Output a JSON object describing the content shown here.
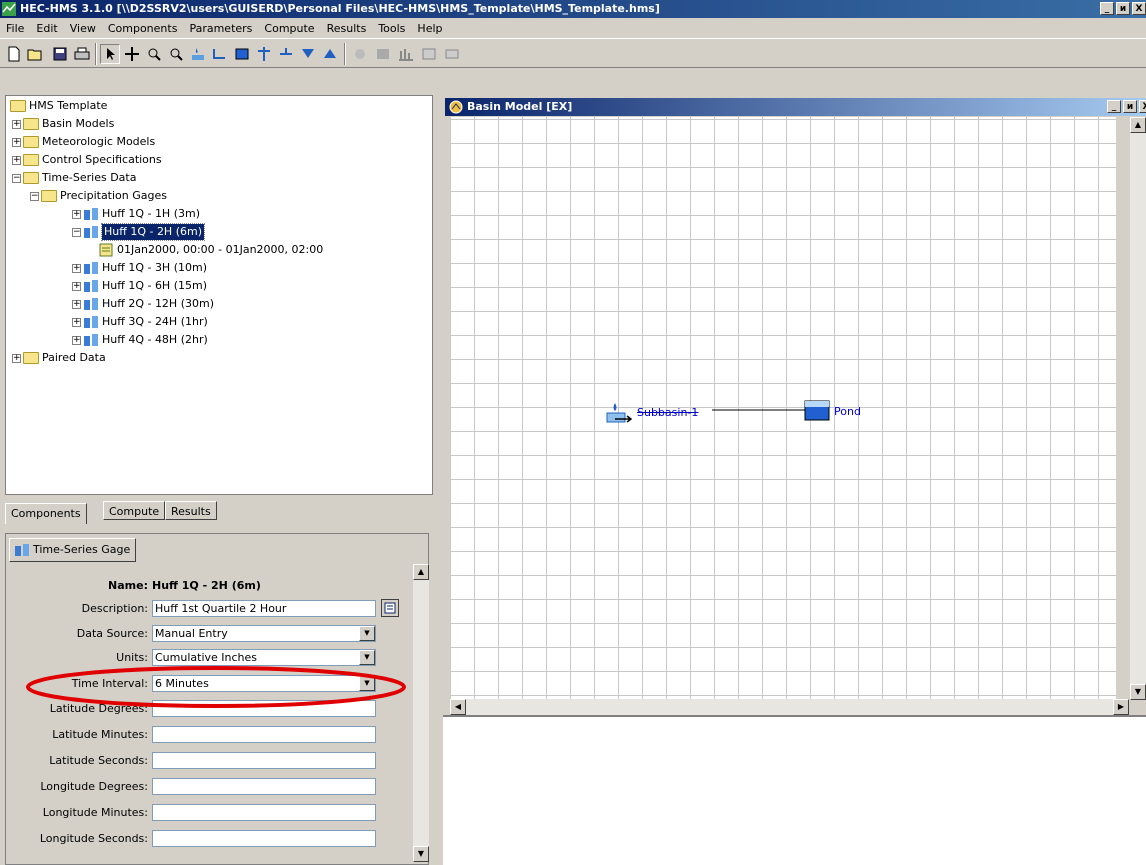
{
  "window": {
    "title": "HEC-HMS 3.1.0 [\\\\D2SSRV2\\users\\GUISERD\\Personal Files\\HEC-HMS\\HMS_Template\\HMS_Template.hms]",
    "minimize": "_",
    "restore": "и",
    "close": "X"
  },
  "menu": [
    "File",
    "Edit",
    "View",
    "Components",
    "Parameters",
    "Compute",
    "Results",
    "Tools",
    "Help"
  ],
  "toolbar_icons": [
    "new-file-icon",
    "open-folder-icon",
    "save-icon",
    "print-icon",
    "arrow-select-icon",
    "pan-icon",
    "zoom-in-icon",
    "zoom-out-icon",
    "subbasin-tool-icon",
    "reach-tool-icon",
    "reservoir-tool-icon",
    "junction-tool-icon",
    "diversion-tool-icon",
    "source-tool-icon",
    "sink-tool-icon",
    "compute-icon",
    "compute-all-icon",
    "graph-icon",
    "table-icon",
    "summary-icon"
  ],
  "tree": {
    "root": "HMS Template",
    "basin_models": "Basin Models",
    "meteorologic_models": "Meteorologic Models",
    "control_specifications": "Control Specifications",
    "time_series_data": "Time-Series Data",
    "precipitation_gages": "Precipitation Gages",
    "gages": [
      "Huff 1Q - 1H (3m)",
      "Huff 1Q - 2H (6m)",
      "Huff 1Q - 3H (10m)",
      "Huff 1Q - 6H (15m)",
      "Huff 2Q - 12H (30m)",
      "Huff 3Q - 24H (1hr)",
      "Huff 4Q - 48H (2hr)"
    ],
    "time_window": "01Jan2000, 00:00 - 01Jan2000, 02:00",
    "paired_data": "Paired Data"
  },
  "tabs": {
    "components": "Components",
    "compute": "Compute",
    "results": "Results"
  },
  "props": {
    "tab": "Time-Series Gage",
    "name_label": "Name:",
    "name_value": "Huff 1Q - 2H (6m)",
    "description_label": "Description:",
    "description_value": "Huff 1st Quartile 2 Hour",
    "data_source_label": "Data Source:",
    "data_source_value": "Manual Entry",
    "units_label": "Units:",
    "units_value": "Cumulative Inches",
    "time_interval_label": "Time Interval:",
    "time_interval_value": "6 Minutes",
    "lat_deg_label": "Latitude Degrees:",
    "lat_min_label": "Latitude Minutes:",
    "lat_sec_label": "Latitude Seconds:",
    "lon_deg_label": "Longitude Degrees:",
    "lon_min_label": "Longitude Minutes:",
    "lon_sec_label": "Longitude Seconds:"
  },
  "basin": {
    "title": "Basin Model [EX]",
    "subbasin": "Subbasin-1",
    "pond": "Pond"
  },
  "colors": {
    "title_blue": "#0a246a",
    "highlight_ellipse": "#e00000",
    "link_blue": "#0000cc"
  }
}
